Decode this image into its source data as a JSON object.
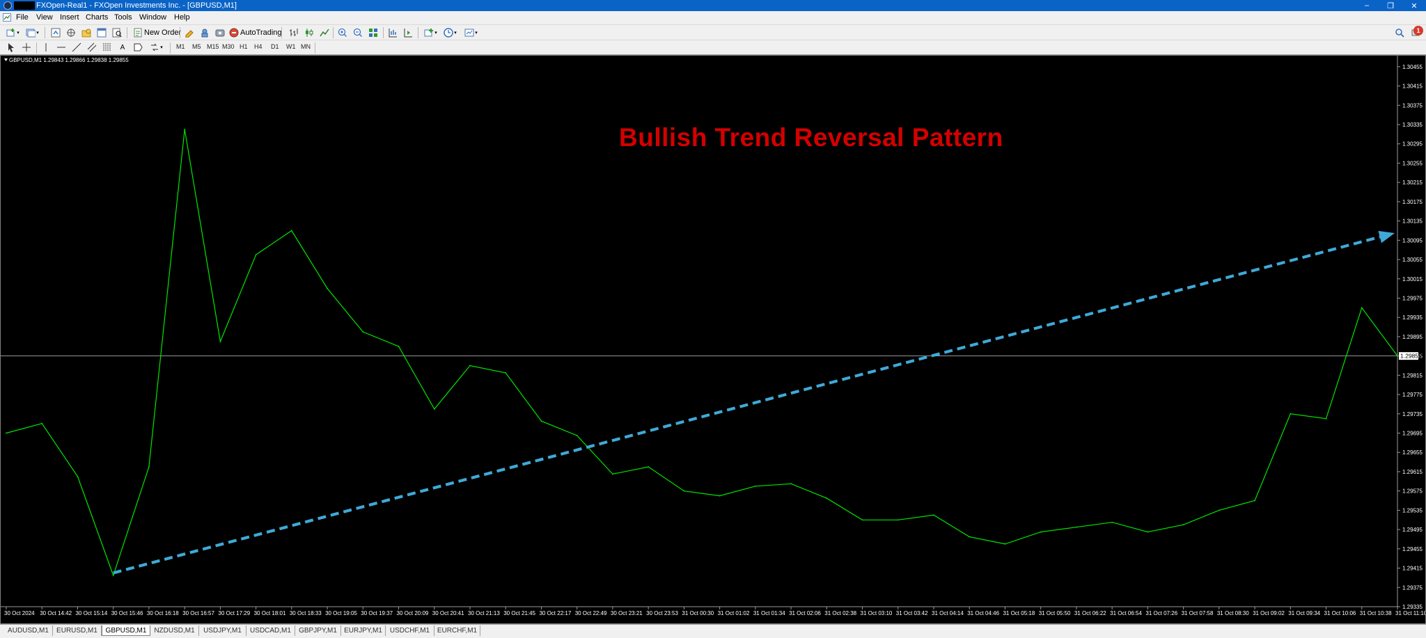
{
  "window": {
    "title": "FXOpen-Real1 - FXOpen Investments Inc. - [GBPUSD,M1]",
    "controls": {
      "minimize": "–",
      "restore": "❐",
      "close": "✕"
    }
  },
  "menu": [
    "File",
    "View",
    "Insert",
    "Charts",
    "Tools",
    "Window",
    "Help"
  ],
  "toolbar": {
    "new_order_label": "New Order",
    "autotrading_label": "AutoTrading",
    "timeframes": [
      "M1",
      "M5",
      "M15",
      "M30",
      "H1",
      "H4",
      "D1",
      "W1",
      "MN"
    ],
    "text_tool_label": "A",
    "notification_count": "1"
  },
  "chart": {
    "info": "GBPUSD,M1  1.29843 1.29866 1.29838 1.29855",
    "annotation": "Bullish Trend Reversal Pattern",
    "current_price": "1.29855",
    "colors": {
      "background": "#000000",
      "price_line": "#00e600",
      "trend_arrow": "#3fa9d8",
      "annotation": "#d40000",
      "axis_text": "#ffffff"
    },
    "price_axis": [
      "1.30455",
      "1.30415",
      "1.30375",
      "1.30335",
      "1.30295",
      "1.30255",
      "1.30215",
      "1.30175",
      "1.30135",
      "1.30095",
      "1.30055",
      "1.30015",
      "1.29975",
      "1.29935",
      "1.29895",
      "1.29855",
      "1.29815",
      "1.29775",
      "1.29735",
      "1.29695",
      "1.29655",
      "1.29615",
      "1.29575",
      "1.29535",
      "1.29495",
      "1.29455",
      "1.29415",
      "1.29375",
      "1.29335"
    ],
    "time_axis": [
      "30 Oct 2024",
      "30 Oct 14:42",
      "30 Oct 15:14",
      "30 Oct 15:46",
      "30 Oct 16:18",
      "30 Oct 16:57",
      "30 Oct 17:29",
      "30 Oct 18:01",
      "30 Oct 18:33",
      "30 Oct 19:05",
      "30 Oct 19:37",
      "30 Oct 20:09",
      "30 Oct 20:41",
      "30 Oct 21:13",
      "30 Oct 21:45",
      "30 Oct 22:17",
      "30 Oct 22:49",
      "30 Oct 23:21",
      "30 Oct 23:53",
      "31 Oct 00:30",
      "31 Oct 01:02",
      "31 Oct 01:34",
      "31 Oct 02:06",
      "31 Oct 02:38",
      "31 Oct 03:10",
      "31 Oct 03:42",
      "31 Oct 04:14",
      "31 Oct 04:46",
      "31 Oct 05:18",
      "31 Oct 05:50",
      "31 Oct 06:22",
      "31 Oct 06:54",
      "31 Oct 07:26",
      "31 Oct 07:58",
      "31 Oct 08:30",
      "31 Oct 09:02",
      "31 Oct 09:34",
      "31 Oct 10:06",
      "31 Oct 10:38",
      "31 Oct 11:10"
    ]
  },
  "chart_data": {
    "type": "line",
    "xlabel": "",
    "ylabel": "",
    "ylim": [
      1.29335,
      1.30475
    ],
    "x": [
      "30 Oct 2024",
      "30 Oct 14:42",
      "30 Oct 15:14",
      "30 Oct 15:46",
      "30 Oct 16:18",
      "30 Oct 16:57",
      "30 Oct 17:29",
      "30 Oct 18:01",
      "30 Oct 18:33",
      "30 Oct 19:05",
      "30 Oct 19:37",
      "30 Oct 20:09",
      "30 Oct 20:41",
      "30 Oct 21:13",
      "30 Oct 21:45",
      "30 Oct 22:17",
      "30 Oct 22:49",
      "30 Oct 23:21",
      "30 Oct 23:53",
      "31 Oct 00:30",
      "31 Oct 01:02",
      "31 Oct 01:34",
      "31 Oct 02:06",
      "31 Oct 02:38",
      "31 Oct 03:10",
      "31 Oct 03:42",
      "31 Oct 04:14",
      "31 Oct 04:46",
      "31 Oct 05:18",
      "31 Oct 05:50",
      "31 Oct 06:22",
      "31 Oct 06:54",
      "31 Oct 07:26",
      "31 Oct 07:58",
      "31 Oct 08:30",
      "31 Oct 09:02",
      "31 Oct 09:34",
      "31 Oct 10:06",
      "31 Oct 10:38",
      "31 Oct 11:10"
    ],
    "series": [
      {
        "values": [
          1.29695,
          1.29715,
          1.29605,
          1.294,
          1.29625,
          1.30325,
          1.29885,
          1.30065,
          1.30115,
          1.29995,
          1.29905,
          1.29875,
          1.29745,
          1.29835,
          1.2982,
          1.2972,
          1.2969,
          1.2961,
          1.29625,
          1.29575,
          1.29565,
          1.29585,
          1.2959,
          1.2956,
          1.29515,
          1.29515,
          1.29525,
          1.2948,
          1.29465,
          1.2949,
          1.295,
          1.2951,
          1.2949,
          1.29505,
          1.29535,
          1.29555,
          1.29735,
          1.29725,
          1.29955,
          1.29855
        ]
      }
    ],
    "current_price": 1.29855,
    "annotations": [
      {
        "type": "arrow",
        "style": "dashed",
        "from": [
          "30 Oct 15:46",
          1.29405
        ],
        "to": [
          "31 Oct 11:10",
          1.3011
        ]
      },
      {
        "type": "text",
        "text": "Bullish Trend Reversal Pattern"
      }
    ]
  },
  "tabs": [
    "AUDUSD,M1",
    "EURUSD,M1",
    "GBPUSD,M1",
    "NZDUSD,M1",
    "USDJPY,M1",
    "USDCAD,M1",
    "GBPJPY,M1",
    "EURJPY,M1",
    "USDCHF,M1",
    "EURCHF,M1"
  ],
  "active_tab": "GBPUSD,M1"
}
